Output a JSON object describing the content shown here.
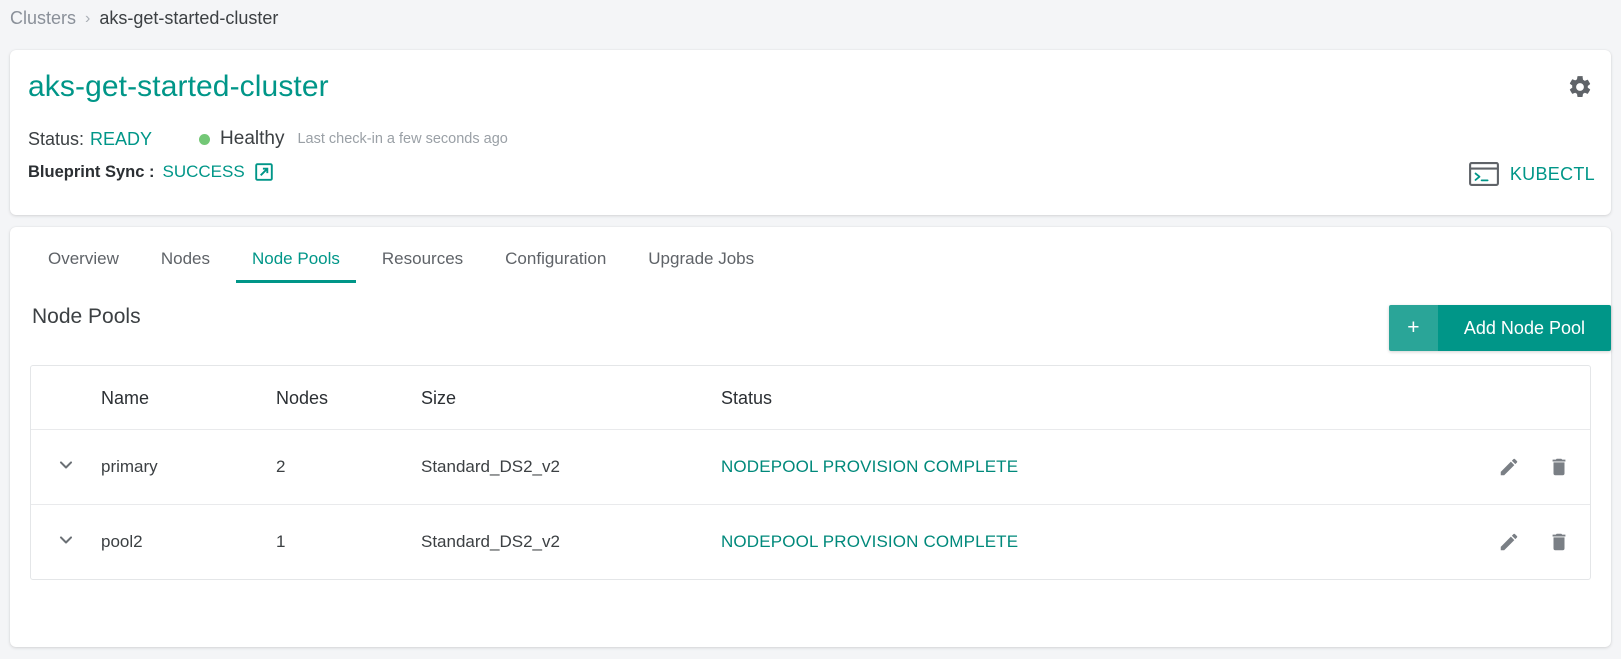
{
  "breadcrumb": {
    "parent": "Clusters",
    "separator": "›",
    "current": "aks-get-started-cluster"
  },
  "header": {
    "title": "aks-get-started-cluster",
    "status_label": "Status:",
    "status_value": "READY",
    "health_text": "Healthy",
    "health_dot_color": "#73c776",
    "checkin_text": "Last check-in a few seconds ago",
    "sync_label": "Blueprint Sync :",
    "sync_value": "SUCCESS",
    "external_link_icon": "external-link-icon",
    "gear_icon": "gear-icon",
    "terminal_icon": "terminal-icon",
    "kubectl_label": "KUBECTL",
    "accent_color": "#009688"
  },
  "tabs": [
    {
      "label": "Overview",
      "active": false
    },
    {
      "label": "Nodes",
      "active": false
    },
    {
      "label": "Node Pools",
      "active": true
    },
    {
      "label": "Resources",
      "active": false
    },
    {
      "label": "Configuration",
      "active": false
    },
    {
      "label": "Upgrade Jobs",
      "active": false
    }
  ],
  "section": {
    "title": "Node Pools",
    "add_button_plus": "+",
    "add_button_label": "Add Node Pool"
  },
  "table": {
    "columns": [
      "",
      "Name",
      "Nodes",
      "Size",
      "Status",
      ""
    ],
    "rows": [
      {
        "expand_icon": "chevron-down-icon",
        "name": "primary",
        "nodes": "2",
        "size": "Standard_DS2_v2",
        "status": "NODEPOOL PROVISION COMPLETE",
        "edit_icon": "pencil-icon",
        "delete_icon": "trash-icon"
      },
      {
        "expand_icon": "chevron-down-icon",
        "name": "pool2",
        "nodes": "1",
        "size": "Standard_DS2_v2",
        "status": "NODEPOOL PROVISION COMPLETE",
        "edit_icon": "pencil-icon",
        "delete_icon": "trash-icon"
      }
    ]
  }
}
